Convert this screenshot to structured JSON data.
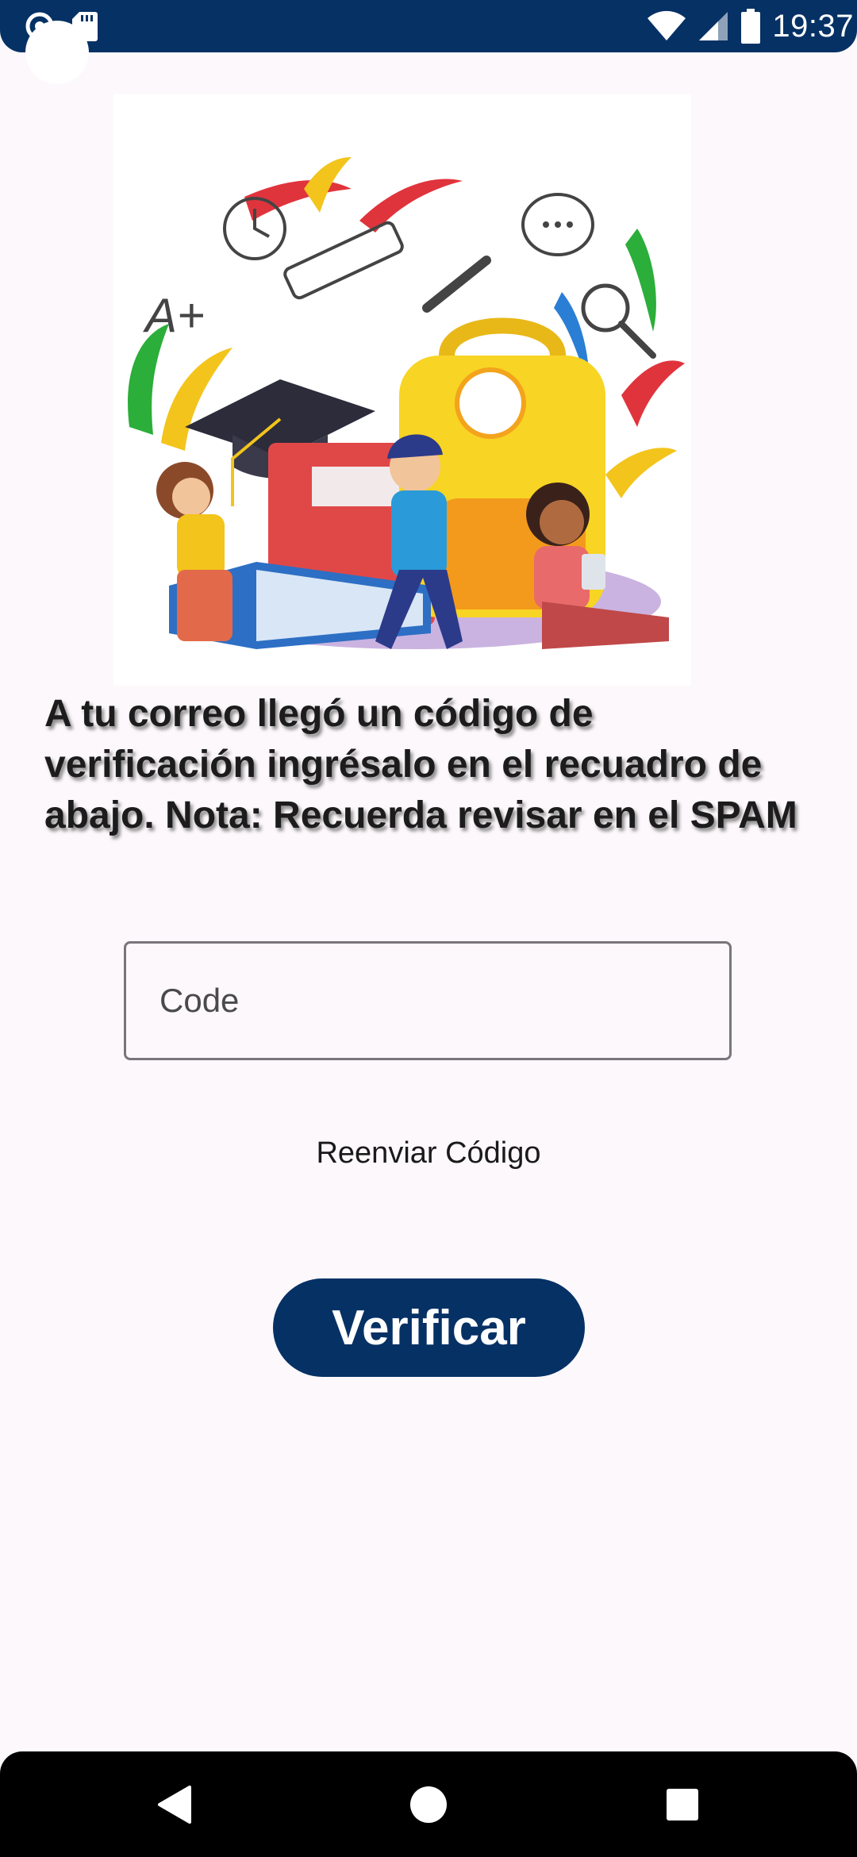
{
  "status_bar": {
    "time": "19:37",
    "icons": [
      "notification-circle-icon",
      "sd-card-icon",
      "wifi-icon",
      "signal-icon",
      "battery-icon"
    ],
    "background": "#063165"
  },
  "main": {
    "illustration": "education-illustration",
    "instruction": "A tu correo llegó un código de verificación ingrésalo en el recuadro de abajo. Nota: Recuerda revisar en el SPAM",
    "code_input": {
      "placeholder": "Code",
      "value": ""
    },
    "resend_label": "Reenviar Código",
    "verify_label": "Verificar",
    "accent": "#063165"
  },
  "nav_bar": {
    "buttons": [
      "back-icon",
      "home-icon",
      "recents-icon"
    ]
  }
}
